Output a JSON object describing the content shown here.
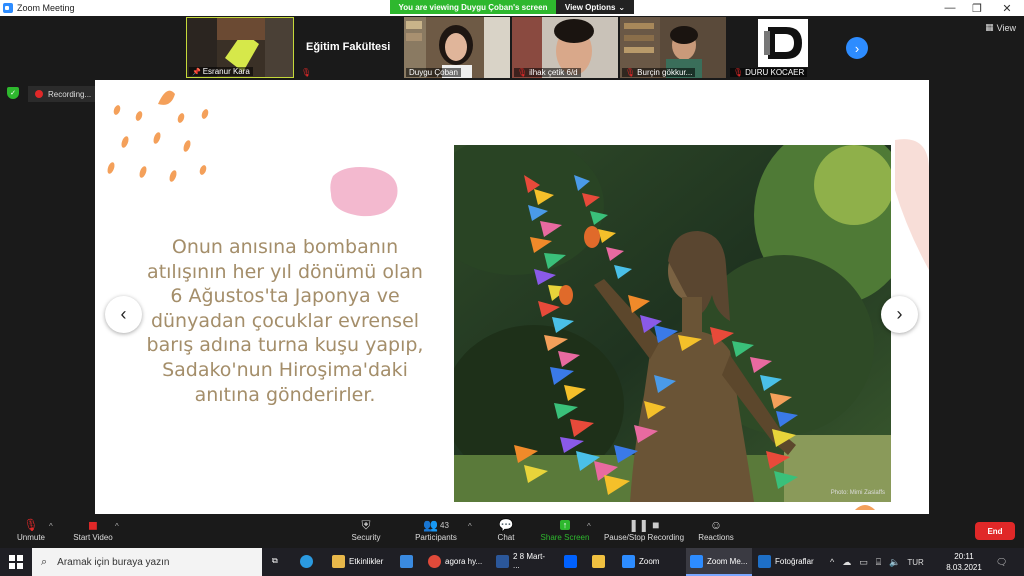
{
  "window": {
    "title": "Zoom Meeting",
    "viewing_banner": "You are viewing Duygu Çoban's screen",
    "view_options": "View Options",
    "view_label": "View"
  },
  "participants": [
    {
      "name": "Esranur Kara",
      "muted": false
    },
    {
      "name": "Eğitim Fakültesi",
      "muted": true
    },
    {
      "name": "Duygu Çoban",
      "muted": false
    },
    {
      "name": "ilhak çetik 6/d",
      "muted": true
    },
    {
      "name": "Burçin gökkur...",
      "muted": true
    },
    {
      "name": "DURU KOCAER",
      "muted": true
    }
  ],
  "recording": {
    "label": "Recording..."
  },
  "slide": {
    "lines": [
      "Onun anısına bombanın",
      "atılışının her yıl dönümü olan",
      "6 Ağustos'ta Japonya ve",
      "dünyadan çocuklar evrensel",
      "barış adına turna kuşu yapıp,",
      "Sadako'nun Hiroşima'daki",
      "anıtına gönderirler."
    ],
    "photo_credit": "Photo: Mimi Zaslaffs"
  },
  "toolbar": {
    "unmute": "Unmute",
    "start_video": "Start Video",
    "security": "Security",
    "participants": "Participants",
    "participant_count": "43",
    "chat": "Chat",
    "share_screen": "Share Screen",
    "pause_stop": "Pause/Stop Recording",
    "reactions": "Reactions",
    "end": "End"
  },
  "taskbar": {
    "search_placeholder": "Aramak için buraya yazın",
    "apps": [
      {
        "label": "Etkinlikler",
        "color": "#e8b84a"
      },
      {
        "label": "agora hy...",
        "color": "#e04a3a"
      },
      {
        "label": "2 8 Mart- ...",
        "color": "#2b579a"
      },
      {
        "label": "Zoom",
        "color": "#2d8cff"
      },
      {
        "label": "Zoom Me...",
        "color": "#2d8cff"
      },
      {
        "label": "Fotoğraflar",
        "color": "#1e6fc7"
      }
    ],
    "language": "TUR",
    "time": "20:11",
    "date": "8.03.2021"
  }
}
